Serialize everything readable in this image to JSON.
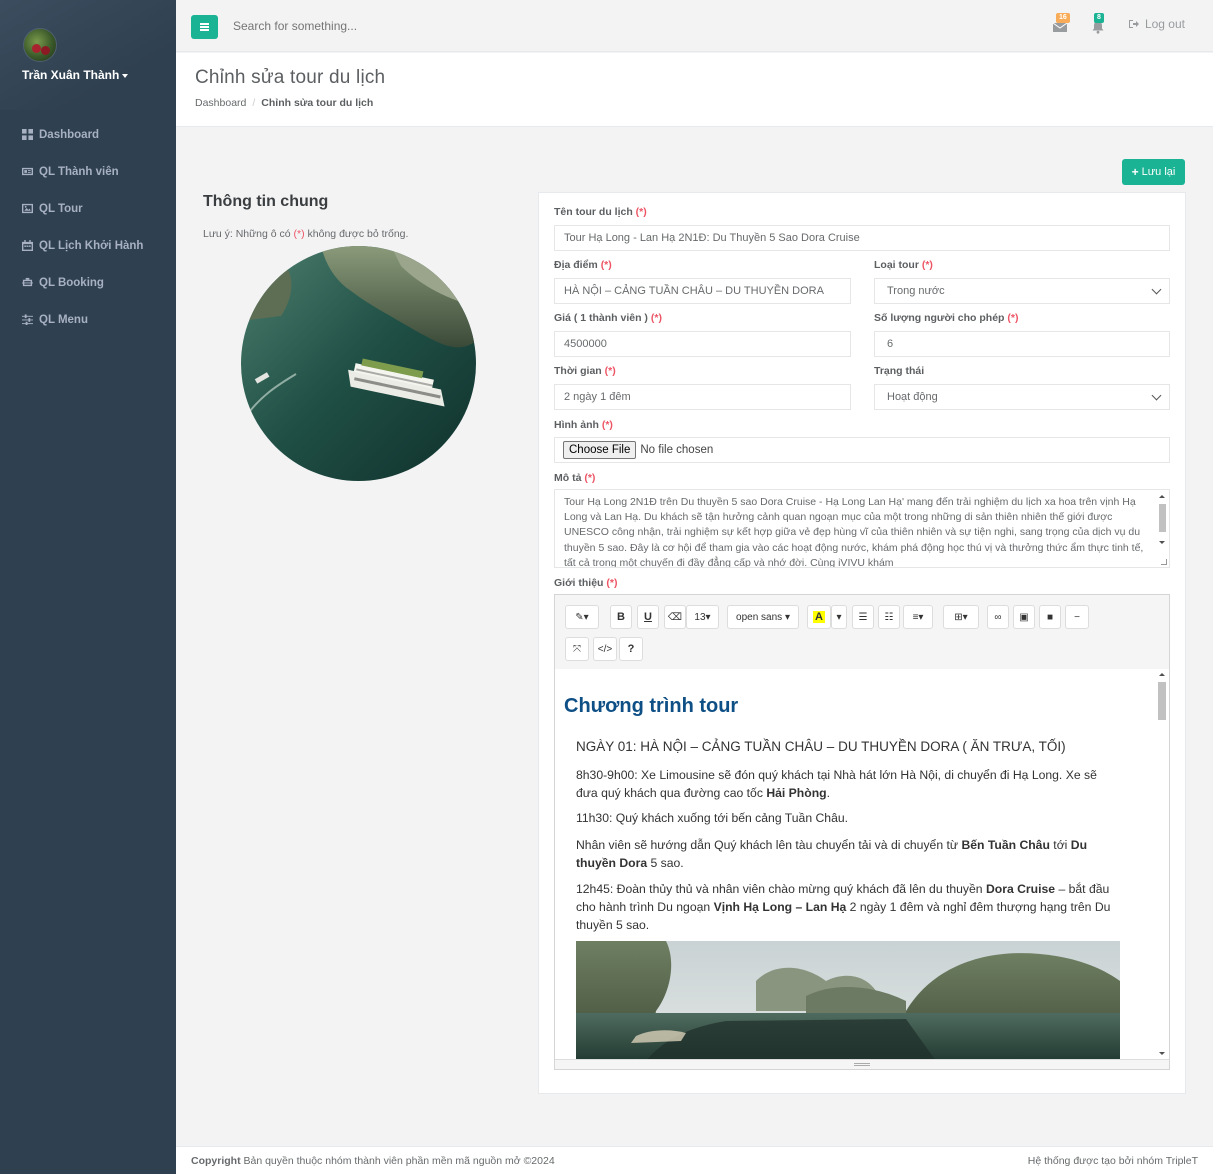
{
  "user": {
    "name": "Trần Xuân Thành"
  },
  "sidebar": {
    "items": [
      {
        "label": "Dashboard",
        "icon": "th-large-icon"
      },
      {
        "label": "QL Thành viên",
        "icon": "id-card-icon"
      },
      {
        "label": "QL Tour",
        "icon": "image-icon"
      },
      {
        "label": "QL Lịch Khởi Hành",
        "icon": "calendar-icon"
      },
      {
        "label": "QL Booking",
        "icon": "booking-icon"
      },
      {
        "label": "QL Menu",
        "icon": "sliders-icon"
      }
    ]
  },
  "topbar": {
    "search_placeholder": "Search for something...",
    "messages_count": "16",
    "alerts_count": "8",
    "logout_label": "Log out"
  },
  "heading": {
    "title": "Chỉnh sửa tour du lịch",
    "breadcrumb_home": "Dashboard",
    "breadcrumb_current": "Chỉnh sửa tour du lịch"
  },
  "actions": {
    "save_label": "Lưu lại"
  },
  "info": {
    "title": "Thông tin chung",
    "note_before": "Lưu ý: Những ô có ",
    "note_req": "(*)",
    "note_after": " không được bỏ trống."
  },
  "form": {
    "required_mark": "(*)",
    "name_label": "Tên tour du lịch",
    "name_value": "Tour Hạ Long - Lan Hạ 2N1Đ: Du Thuyền 5 Sao Dora Cruise",
    "location_label": "Địa điểm",
    "location_value": "HÀ NỘI – CẢNG TUẦN CHÂU – DU THUYỀN DORA",
    "type_label": "Loại tour",
    "type_value": "Trong nước",
    "price_label": "Giá ( 1 thành viên )",
    "price_value": "4500000",
    "capacity_label": "Số lượng người cho phép",
    "capacity_value": "6",
    "duration_label": "Thời gian",
    "duration_value": "2 ngày 1 đêm",
    "status_label": "Trạng thái",
    "status_value": "Hoạt động",
    "image_label": "Hình ảnh",
    "file_button": "Choose File",
    "file_status": "No file chosen",
    "desc_label": "Mô tả",
    "desc_value": "Tour Hạ Long 2N1Đ trên Du thuyền 5 sao Dora Cruise - Hạ Long Lan Hạ' mang đến trải nghiệm du lịch xa hoa trên vịnh Hạ Long và Lan Hạ. Du khách sẽ tận hưởng cảnh quan ngoạn mục của một trong những di sản thiên nhiên thế giới được UNESCO công nhận, trải nghiệm sự kết hợp giữa vẻ đẹp hùng vĩ của thiên nhiên và sự tiện nghi, sang trọng của dịch vụ du thuyền 5 sao. Đây là cơ hội để tham gia vào các hoạt động nước, khám phá động học thú vị và thưởng thức ẩm thực tinh tế, tất cả trong một chuyến đi đầy đẳng cấp và nhớ đời. Cùng iVIVU khám",
    "intro_label": "Giới thiệu"
  },
  "editor": {
    "font_size": "13",
    "font_family": "open sans",
    "h1": "Chương trình tour",
    "h3": "NGÀY 01: HÀ NỘI – CẢNG TUẦN CHÂU – DU THUYỀN DORA ( ĂN TRƯA, TỐI)",
    "p1_a": "8h30-9h00: Xe Limousine sẽ đón quý khách tại Nhà hát lớn Hà Nội, di chuyển đi Hạ Long. Xe sẽ đưa quý khách qua đường cao tốc ",
    "p1_b": "Hải Phòng",
    "p1_c": ".",
    "p2": "11h30: Quý khách xuống tới bến cảng Tuần Châu.",
    "p3_a": "Nhân viên sẽ hướng dẫn Quý khách lên tàu chuyển tải và di chuyển từ ",
    "p3_b": "Bến Tuần Châu",
    "p3_c": " tới ",
    "p3_d": "Du thuyền Dora",
    "p3_e": " 5 sao.",
    "p4_a": "12h45: Đoàn thủy thủ và nhân viên chào mừng quý khách đã lên du thuyền ",
    "p4_b": "Dora Cruise",
    "p4_c": " – bắt đầu cho hành trình Du ngoạn ",
    "p4_d": "Vịnh Hạ Long – Lan Hạ",
    "p4_e": " 2 ngày 1 đêm và nghỉ đêm thượng hạng trên Du thuyền 5 sao."
  },
  "footer": {
    "copyright_bold": "Copyright",
    "copyright_text": " Bản quyền thuộc nhóm thành viên phần mền mã nguồn mở ©2024",
    "right": "Hệ thống được tạo bởi nhóm TripleT"
  },
  "colors": {
    "primary": "#1ab394",
    "sidebar": "#2f4050",
    "required": "#ed5565",
    "heading_blue": "#0e4f86"
  }
}
